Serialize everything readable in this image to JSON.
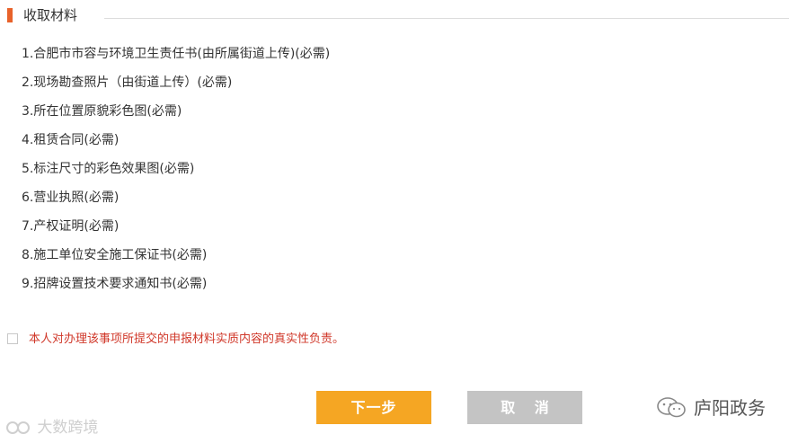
{
  "section": {
    "title": "收取材料"
  },
  "materials": [
    "1.合肥市市容与环境卫生责任书(由所属街道上传)(必需)",
    "2.现场勘查照片（由街道上传）(必需)",
    "3.所在位置原貌彩色图(必需)",
    "4.租赁合同(必需)",
    "5.标注尺寸的彩色效果图(必需)",
    "6.营业执照(必需)",
    "7.产权证明(必需)",
    "8.施工单位安全施工保证书(必需)",
    "9.招牌设置技术要求通知书(必需)"
  ],
  "consent": {
    "checked": false,
    "text": "本人对办理该事项所提交的申报材料实质内容的真实性负责。"
  },
  "buttons": {
    "next": "下一步",
    "cancel": "取 消"
  },
  "watermarks": {
    "left": "大数跨境",
    "right": "庐阳政务"
  },
  "colors": {
    "accent": "#e8622a",
    "next_button": "#f5a623",
    "cancel_button": "#c4c4c4",
    "consent_text": "#d0382a"
  }
}
